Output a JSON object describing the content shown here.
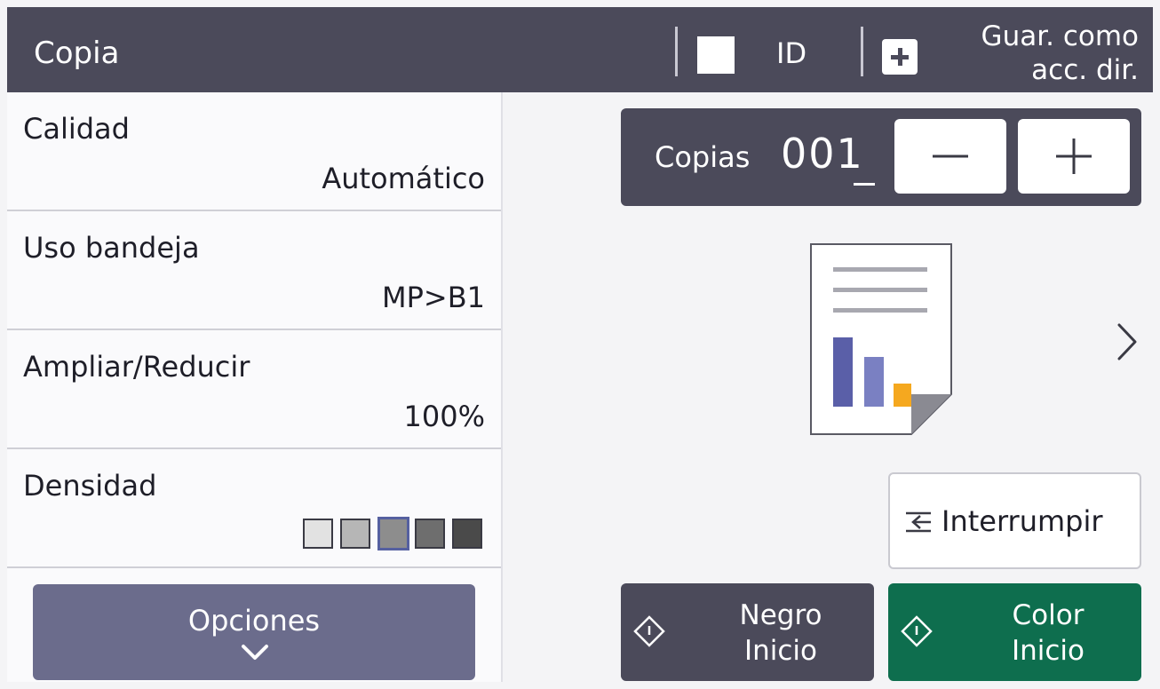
{
  "header": {
    "title": "Copia",
    "id_label": "ID",
    "shortcut_line1": "Guar. como",
    "shortcut_line2": "acc. dir."
  },
  "settings": [
    {
      "label": "Calidad",
      "value": "Automático"
    },
    {
      "label": "Uso bandeja",
      "value": "MP>B1"
    },
    {
      "label": "Ampliar/Reducir",
      "value": "100%"
    },
    {
      "label": "Densidad",
      "value": ""
    }
  ],
  "density": {
    "levels": 5,
    "selected": 3,
    "colors": [
      "#e2e2e2",
      "#b6b6b6",
      "#8d8d8d",
      "#6e6e6e",
      "#4a4a4a"
    ]
  },
  "options_button": {
    "label": "Opciones",
    "icon": "chevron-down-icon"
  },
  "copies": {
    "label": "Copias",
    "value": "001"
  },
  "interrupt_button": {
    "label": "Interrumpir",
    "icon": "interrupt-icon"
  },
  "black_start": {
    "line1": "Negro",
    "line2": "Inicio",
    "icon": "start-diamond-icon"
  },
  "color_start": {
    "line1": "Color",
    "line2": "Inicio",
    "icon": "start-diamond-icon"
  },
  "colors": {
    "header_bg": "#4b4a5a",
    "options_bg": "#6b6c8c",
    "color_start_bg": "#0e6e4e",
    "doc_bar_1": "#5a5fa8",
    "doc_bar_2": "#7a80c2",
    "doc_accent": "#f5a81f"
  }
}
